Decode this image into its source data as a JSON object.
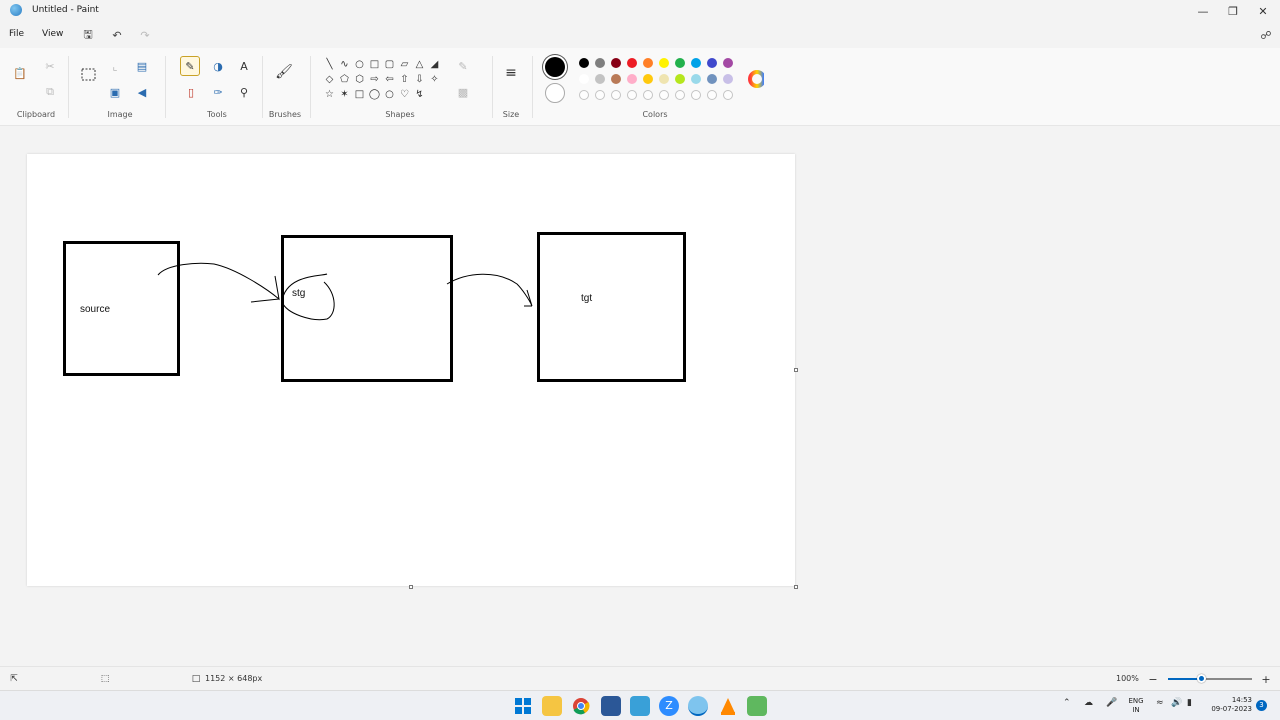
{
  "window": {
    "title": "Untitled - Paint",
    "minimize_icon": "minimize-icon",
    "maximize_icon": "restore-icon",
    "close_icon": "close-icon"
  },
  "menu": {
    "items": [
      "File",
      "View"
    ],
    "quick_access": [
      "save-icon",
      "undo-icon",
      "redo-icon"
    ],
    "settings_icon": "share-icon"
  },
  "ribbon": {
    "groups": [
      "Clipboard",
      "Image",
      "Tools",
      "Brushes",
      "Shapes",
      "Size",
      "Colors"
    ],
    "selected_tool": "pencil",
    "primary_color": "#000000",
    "secondary_color": "#ffffff",
    "palette_row1": [
      "#000000",
      "#7f7f7f",
      "#880015",
      "#ed1c24",
      "#ff7f27",
      "#fff200",
      "#22b14c",
      "#00a2e8",
      "#3f48cc",
      "#a349a4"
    ],
    "palette_row2": [
      "#ffffff",
      "#c3c3c3",
      "#b97a57",
      "#ffaec9",
      "#ffc90e",
      "#efe4b0",
      "#b5e61d",
      "#99d9ea",
      "#7092be",
      "#c8bfe7"
    ]
  },
  "canvas": {
    "labels": {
      "source": "source",
      "stg": "stg",
      "tgt": "tgt"
    }
  },
  "status": {
    "canvas_size": "1152 × 648px",
    "zoom": "100%",
    "zoom_level": 0.4
  },
  "taskbar": {
    "apps": [
      "windows-start-icon",
      "file-explorer-icon",
      "chrome-icon",
      "store-icon",
      "notepad-icon",
      "zoom-icon",
      "paint-icon",
      "vlc-icon",
      "editor-icon"
    ],
    "lang_top": "ENG",
    "lang_bottom": "IN",
    "time": "14:53",
    "date": "09-07-2023",
    "notifications": "3"
  }
}
